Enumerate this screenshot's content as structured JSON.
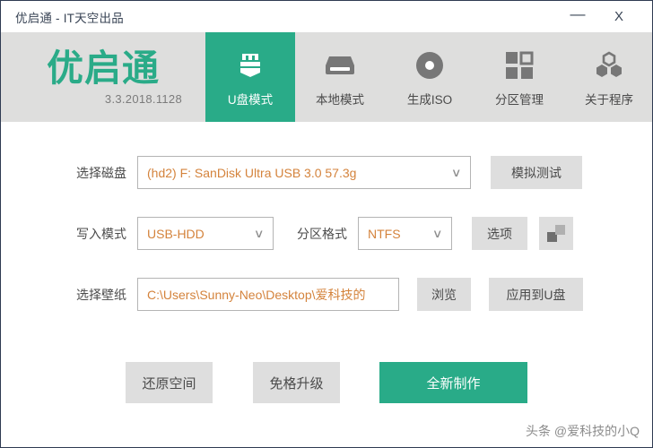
{
  "window": {
    "title": "优启通 - IT天空出品",
    "controls": {
      "minimize": "—",
      "close": "X"
    }
  },
  "brand": {
    "logo": "优启通",
    "version": "3.3.2018.1128",
    "accent_color": "#29ab88",
    "header_bg": "#dededd"
  },
  "nav": {
    "items": [
      {
        "label": "U盘模式",
        "icon": "usb-drive-icon",
        "active": true
      },
      {
        "label": "本地模式",
        "icon": "hard-disk-icon",
        "active": false
      },
      {
        "label": "生成ISO",
        "icon": "disc-icon",
        "active": false
      },
      {
        "label": "分区管理",
        "icon": "grid-icon",
        "active": false
      },
      {
        "label": "关于程序",
        "icon": "hexagons-icon",
        "active": false
      }
    ]
  },
  "form": {
    "disk": {
      "label": "选择磁盘",
      "value": "(hd2) F: SanDisk Ultra USB 3.0 57.3g",
      "test_button": "模拟测试"
    },
    "write_mode": {
      "label": "写入模式",
      "value": "USB-HDD"
    },
    "partition_format": {
      "label": "分区格式",
      "value": "NTFS",
      "options_button": "选项",
      "extra_button_icon": "two-squares-icon"
    },
    "wallpaper": {
      "label": "选择壁纸",
      "value": "C:\\Users\\Sunny-Neo\\Desktop\\爱科技的",
      "browse_button": "浏览",
      "apply_button": "应用到U盘"
    }
  },
  "actions": {
    "restore": "还原空间",
    "upgrade": "免格升级",
    "make": "全新制作"
  },
  "watermark": {
    "text": "头条 @爱科技的小Q"
  }
}
